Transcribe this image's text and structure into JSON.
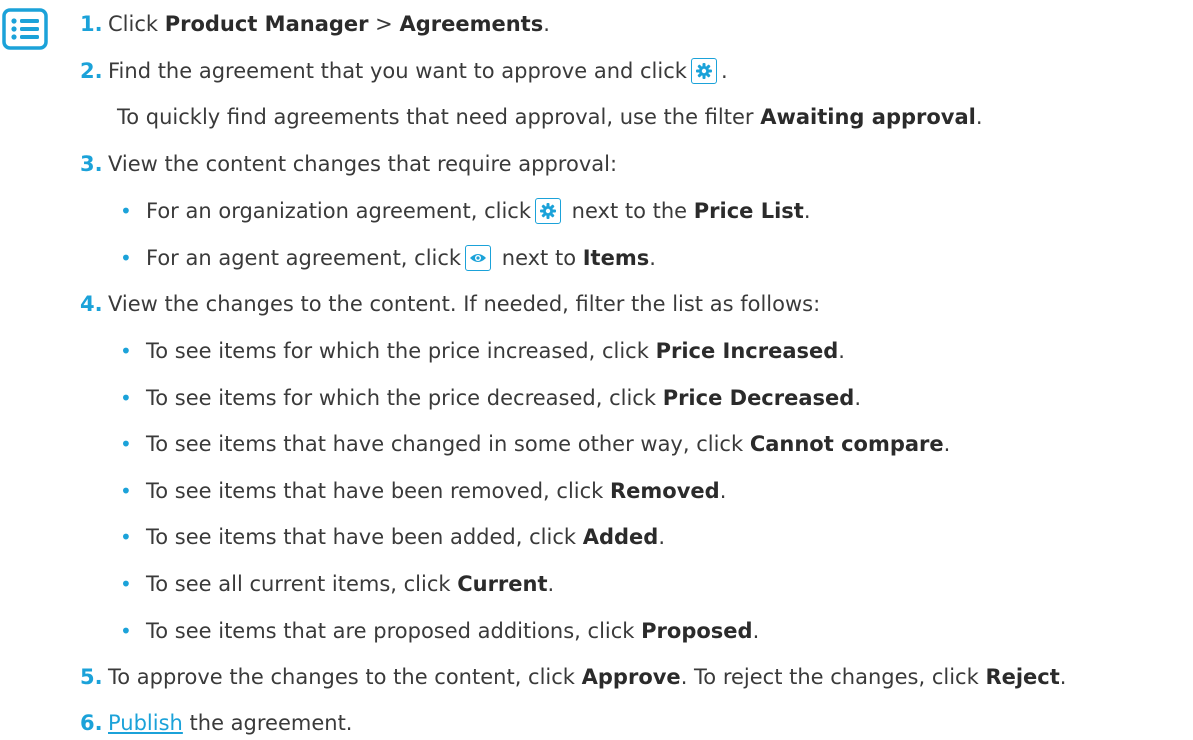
{
  "icons": {
    "procedure": "list-icon",
    "gear": "gear-icon",
    "eye": "eye-icon"
  },
  "colors": {
    "accent": "#1ba2d9",
    "text": "#3a3a3a"
  },
  "steps": [
    {
      "num": "1.",
      "pre": "Click ",
      "b1": "Product Manager",
      "mid": " > ",
      "b2": "Agreements",
      "post": "."
    },
    {
      "num": "2.",
      "pre": "Find the agreement that you want to approve and click",
      "post": "."
    },
    {
      "note_pre": "To quickly find agreements that need approval, use the filter ",
      "note_b": "Awaiting approval",
      "note_post": "."
    },
    {
      "num": "3.",
      "text": "View the content changes that require approval:",
      "bullets": [
        {
          "pre": "For an organization agreement, click",
          "mid": " next to the ",
          "b": "Price List",
          "post": "."
        },
        {
          "pre": "For an agent agreement, click",
          "mid": " next to ",
          "b": "Items",
          "post": "."
        }
      ]
    },
    {
      "num": "4.",
      "text": "View the changes to the content. If needed, filter the list as follows:",
      "bullets": [
        {
          "pre": "To see items for which the price increased, click ",
          "b": "Price Increased",
          "post": "."
        },
        {
          "pre": "To see items for which the price decreased, click ",
          "b": "Price Decreased",
          "post": "."
        },
        {
          "pre": "To see items that have changed in some other way, click ",
          "b": "Cannot compare",
          "post": "."
        },
        {
          "pre": "To see items that have been removed, click ",
          "b": "Removed",
          "post": "."
        },
        {
          "pre": "To see items that have been added, click ",
          "b": "Added",
          "post": "."
        },
        {
          "pre": "To see all current items, click ",
          "b": "Current",
          "post": "."
        },
        {
          "pre": "To see items that are proposed additions, click ",
          "b": "Proposed",
          "post": "."
        }
      ]
    },
    {
      "num": "5.",
      "pre": "To approve the changes to the content, click ",
      "b1": "Approve",
      "mid": ". To reject the changes, click ",
      "b2": "Reject",
      "post": "."
    },
    {
      "num": "6.",
      "link": "Publish",
      "post": " the agreement."
    }
  ],
  "bullet_char": "•"
}
